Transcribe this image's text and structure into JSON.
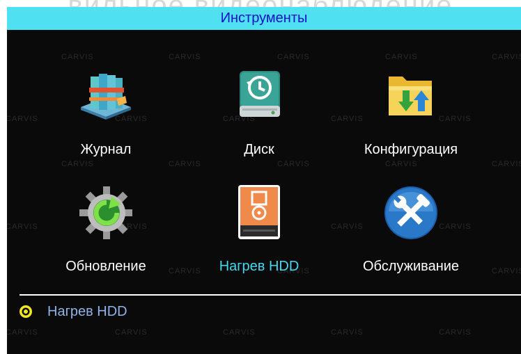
{
  "background_text": "вильное видеонаблюдение",
  "title": "Инструменты",
  "watermark": "CARVIS",
  "tiles": [
    {
      "label": "Журнал",
      "icon": "log-books-icon",
      "selected": false
    },
    {
      "label": "Диск",
      "icon": "disk-history-icon",
      "selected": false
    },
    {
      "label": "Конфигурация",
      "icon": "config-folder-icon",
      "selected": false
    },
    {
      "label": "Обновление",
      "icon": "update-gear-icon",
      "selected": false
    },
    {
      "label": "Нагрев HDD",
      "icon": "hdd-heating-icon",
      "selected": true
    },
    {
      "label": "Обслуживание",
      "icon": "maintenance-tools-icon",
      "selected": false
    }
  ],
  "status": {
    "label": "Нагрев HDD",
    "icon": "radio-dot-icon"
  },
  "colors": {
    "title_bar": "#4fe0f2",
    "title_text": "#1010c8",
    "selected_label": "#44d8f0",
    "status_text": "#8fb4e8",
    "status_dot": "#f2e81c"
  }
}
